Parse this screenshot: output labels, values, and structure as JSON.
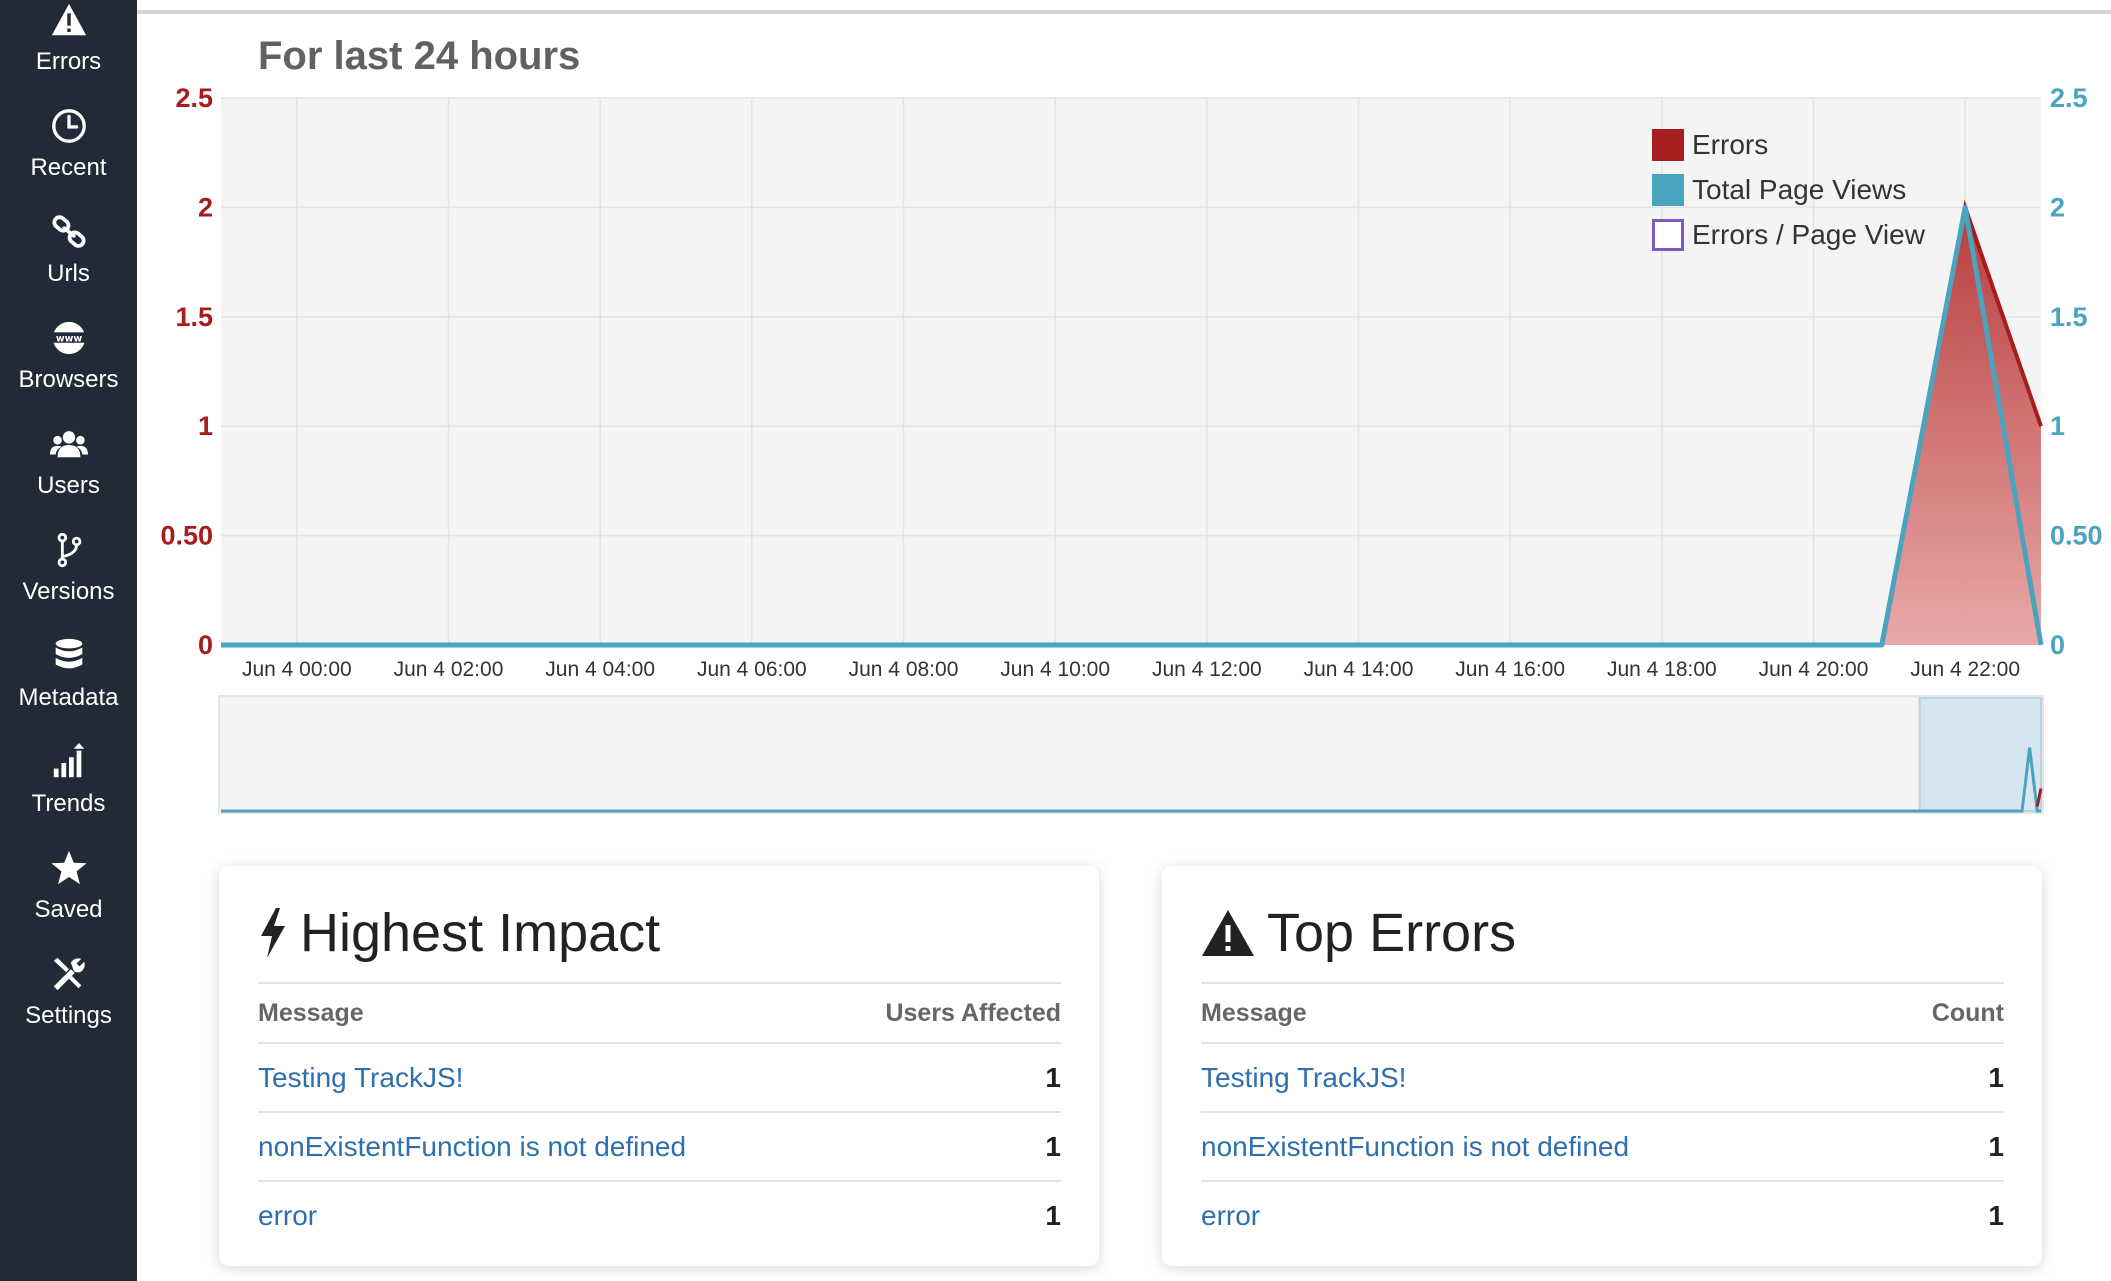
{
  "sidebar": {
    "items": [
      {
        "label": "Errors",
        "icon": "warning-triangle-icon"
      },
      {
        "label": "Recent",
        "icon": "clock-icon"
      },
      {
        "label": "Urls",
        "icon": "link-icon"
      },
      {
        "label": "Browsers",
        "icon": "globe-www-icon"
      },
      {
        "label": "Users",
        "icon": "users-icon"
      },
      {
        "label": "Versions",
        "icon": "code-branch-icon"
      },
      {
        "label": "Metadata",
        "icon": "database-icon"
      },
      {
        "label": "Trends",
        "icon": "bar-trend-icon"
      },
      {
        "label": "Saved",
        "icon": "star-icon"
      },
      {
        "label": "Settings",
        "icon": "tools-icon"
      }
    ]
  },
  "page": {
    "title": "For last 24 hours"
  },
  "colors": {
    "errors": "#a71d1d",
    "page_views": "#4aa3bf",
    "errors_per_view": "#7d5bbe",
    "link": "#2f6fae"
  },
  "chart_data": {
    "type": "area",
    "x": [
      "Jun 4 00:00",
      "Jun 4 02:00",
      "Jun 4 04:00",
      "Jun 4 06:00",
      "Jun 4 08:00",
      "Jun 4 10:00",
      "Jun 4 12:00",
      "Jun 4 14:00",
      "Jun 4 16:00",
      "Jun 4 18:00",
      "Jun 4 20:00",
      "Jun 4 22:00"
    ],
    "x_hours": [
      0,
      2,
      4,
      6,
      8,
      10,
      12,
      14,
      16,
      18,
      20,
      22
    ],
    "y_left_ticks": [
      "0",
      "0.50",
      "1",
      "1.5",
      "2",
      "2.5"
    ],
    "y_right_ticks": [
      "0",
      "0.50",
      "1",
      "1.5",
      "2",
      "2.5"
    ],
    "ylim": [
      0,
      2.5
    ],
    "xlim_hours": [
      -1,
      23
    ],
    "series": [
      {
        "name": "Errors",
        "points": [
          [
            -1,
            0
          ],
          [
            20.9,
            0
          ],
          [
            22,
            2
          ],
          [
            23,
            1
          ]
        ]
      },
      {
        "name": "Total Page Views",
        "points": [
          [
            -1,
            0
          ],
          [
            20.9,
            0
          ],
          [
            22,
            2
          ],
          [
            23,
            0
          ]
        ]
      },
      {
        "name": "Errors / Page View",
        "points": []
      }
    ],
    "legend_position": "top-right",
    "grid": true,
    "navigator_selection_hours": [
      21.4,
      23
    ]
  },
  "highest_impact": {
    "title": "Highest Impact",
    "col_message": "Message",
    "col_value": "Users Affected",
    "rows": [
      {
        "message": "Testing TrackJS!",
        "value": "1"
      },
      {
        "message": "nonExistentFunction is not defined",
        "value": "1"
      },
      {
        "message": "error",
        "value": "1"
      }
    ]
  },
  "top_errors": {
    "title": "Top Errors",
    "col_message": "Message",
    "col_value": "Count",
    "rows": [
      {
        "message": "Testing TrackJS!",
        "value": "1"
      },
      {
        "message": "nonExistentFunction is not defined",
        "value": "1"
      },
      {
        "message": "error",
        "value": "1"
      }
    ]
  }
}
